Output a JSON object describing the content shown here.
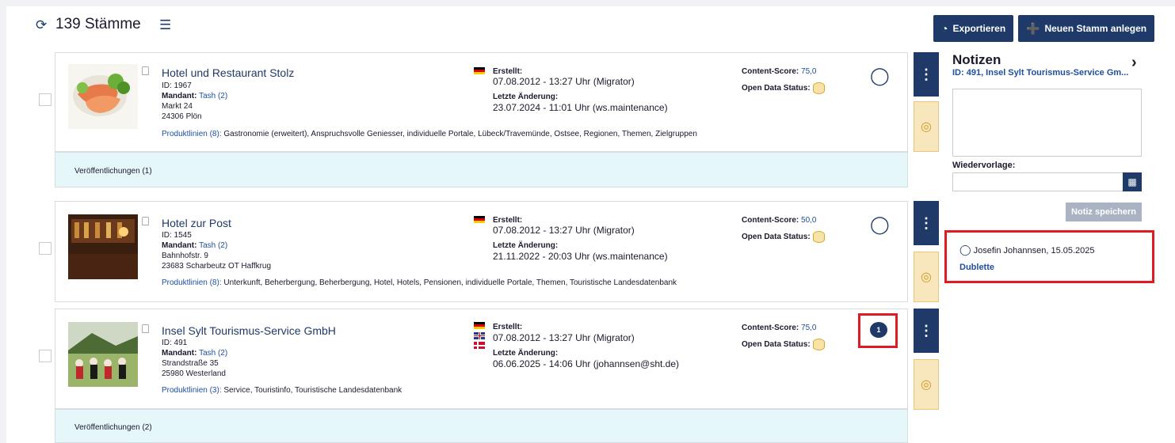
{
  "header": {
    "count_label": "139 Stämme",
    "export_label": "Exportieren",
    "new_label": "Neuen Stamm anlegen"
  },
  "cards": [
    {
      "title": "Hotel und Restaurant Stolz",
      "id": "ID: 1967",
      "mandant_label": "Mandant:",
      "mandant_value": "Tash (2)",
      "street": "Markt 24",
      "city": "24306 Plön",
      "produktlinien_label": "Produktlinien (8):",
      "produktlinien_value": "Gastronomie (erweitert), Anspruchsvolle Geniesser, individuelle Portale, Lübeck/Travemünde, Ostsee, Regionen, Themen, Zielgruppen",
      "created_label": "Erstellt:",
      "created_value": "07.08.2012 - 13:27 Uhr (Migrator)",
      "changed_label": "Letzte Änderung:",
      "changed_value": "23.07.2024 - 11:01 Uhr (ws.maintenance)",
      "score_label": "Content-Score:",
      "score_value": "75,0",
      "open_data_label": "Open Data Status:",
      "publications": "Veröffentlichungen (1)"
    },
    {
      "title": "Hotel zur Post",
      "id": "ID: 1545",
      "mandant_label": "Mandant:",
      "mandant_value": "Tash (2)",
      "street": "Bahnhofstr. 9",
      "city": "23683 Scharbeutz OT Haffkrug",
      "produktlinien_label": "Produktlinien (8):",
      "produktlinien_value": "Unterkunft, Beherbergung, Beherbergung, Hotel, Hotels, Pensionen, individuelle Portale, Themen, Touristische Landesdatenbank",
      "created_label": "Erstellt:",
      "created_value": "07.08.2012 - 13:27 Uhr (Migrator)",
      "changed_label": "Letzte Änderung:",
      "changed_value": "21.11.2022 - 20:03 Uhr (ws.maintenance)",
      "score_label": "Content-Score:",
      "score_value": "50,0",
      "open_data_label": "Open Data Status:"
    },
    {
      "title": "Insel Sylt Tourismus-Service GmbH",
      "id": "ID: 491",
      "mandant_label": "Mandant:",
      "mandant_value": "Tash (2)",
      "street": "Strandstraße 35",
      "city": "25980 Westerland",
      "produktlinien_label": "Produktlinien (3):",
      "produktlinien_value": "Service, Touristinfo, Touristische Landesdatenbank",
      "created_label": "Erstellt:",
      "created_value": "07.08.2012 - 13:27 Uhr (Migrator)",
      "changed_label": "Letzte Änderung:",
      "changed_value": "06.06.2025 - 14:06 Uhr (johannsen@sht.de)",
      "score_label": "Content-Score:",
      "score_value": "75,0",
      "open_data_label": "Open Data Status:",
      "comment_count": "1",
      "publications": "Veröffentlichungen (2)"
    }
  ],
  "notes": {
    "title": "Notizen",
    "subtitle": "ID: 491, Insel Sylt Tourismus-Service Gm...",
    "wiedervorlage_label": "Wiedervorlage:",
    "save_label": "Notiz speichern",
    "entry_author": "Josefin Johannsen, 15.05.2025",
    "entry_text": "Dublette"
  },
  "colors": {
    "primary": "#1f3a68",
    "highlight": "#e01b24",
    "publication_bg": "#e6f7fa"
  }
}
